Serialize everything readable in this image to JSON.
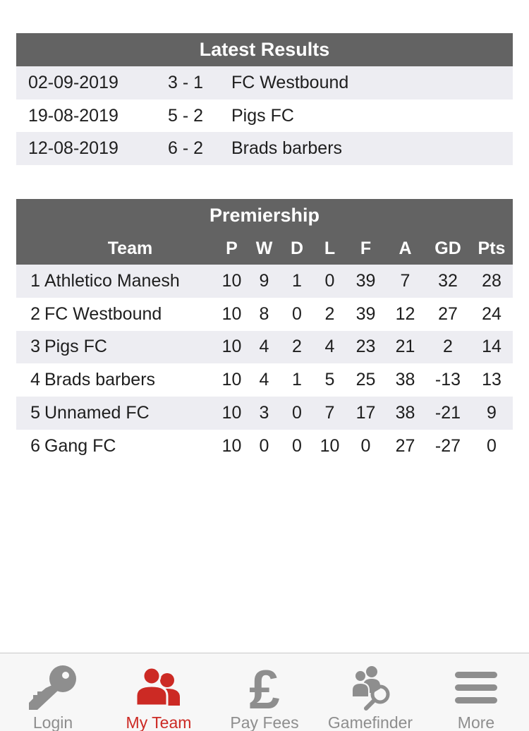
{
  "latest_results": {
    "title": "Latest Results",
    "rows": [
      {
        "date": "02-09-2019",
        "score": "3 - 1",
        "opponent": "FC Westbound"
      },
      {
        "date": "19-08-2019",
        "score": "5 - 2",
        "opponent": "Pigs FC"
      },
      {
        "date": "12-08-2019",
        "score": "6 - 2",
        "opponent": "Brads barbers"
      }
    ]
  },
  "league": {
    "title": "Premiership",
    "columns": [
      "Team",
      "P",
      "W",
      "D",
      "L",
      "F",
      "A",
      "GD",
      "Pts"
    ],
    "rows": [
      {
        "pos": "1",
        "team": "Athletico Manesh",
        "p": "10",
        "w": "9",
        "d": "1",
        "l": "0",
        "f": "39",
        "a": "7",
        "gd": "32",
        "pts": "28"
      },
      {
        "pos": "2",
        "team": "FC Westbound",
        "p": "10",
        "w": "8",
        "d": "0",
        "l": "2",
        "f": "39",
        "a": "12",
        "gd": "27",
        "pts": "24"
      },
      {
        "pos": "3",
        "team": "Pigs FC",
        "p": "10",
        "w": "4",
        "d": "2",
        "l": "4",
        "f": "23",
        "a": "21",
        "gd": "2",
        "pts": "14"
      },
      {
        "pos": "4",
        "team": "Brads barbers",
        "p": "10",
        "w": "4",
        "d": "1",
        "l": "5",
        "f": "25",
        "a": "38",
        "gd": "-13",
        "pts": "13"
      },
      {
        "pos": "5",
        "team": "Unnamed FC",
        "p": "10",
        "w": "3",
        "d": "0",
        "l": "7",
        "f": "17",
        "a": "38",
        "gd": "-21",
        "pts": "9"
      },
      {
        "pos": "6",
        "team": "Gang FC",
        "p": "10",
        "w": "0",
        "d": "0",
        "l": "10",
        "f": "0",
        "a": "27",
        "gd": "-27",
        "pts": "0"
      }
    ]
  },
  "tabbar": {
    "tabs": [
      {
        "label": "Login",
        "icon": "key-icon",
        "active": false
      },
      {
        "label": "My Team",
        "icon": "team-icon",
        "active": true
      },
      {
        "label": "Pay Fees",
        "icon": "pound-icon",
        "active": false
      },
      {
        "label": "Gamefinder",
        "icon": "gamefinder-icon",
        "active": false
      },
      {
        "label": "More",
        "icon": "menu-icon",
        "active": false
      }
    ],
    "active_color": "#cc2a24",
    "inactive_color": "#8e8e8e"
  }
}
